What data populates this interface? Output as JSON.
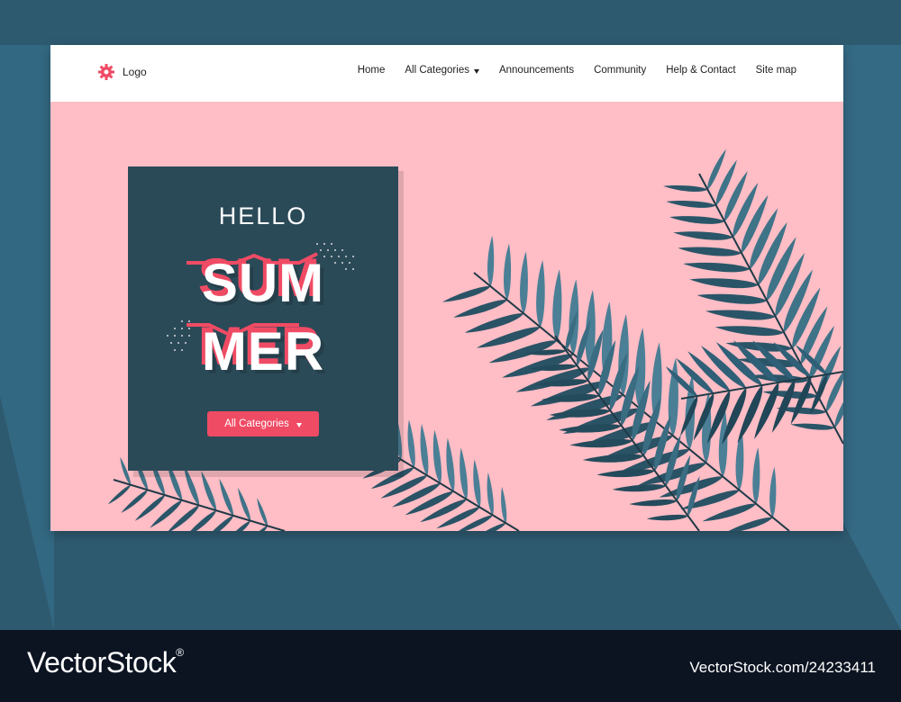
{
  "navbar": {
    "logo_label": "Logo",
    "items": [
      {
        "label": "Home"
      },
      {
        "label": "All Categories"
      },
      {
        "label": "Announcements"
      },
      {
        "label": "Community"
      },
      {
        "label": "Help & Contact"
      },
      {
        "label": "Site map"
      }
    ]
  },
  "hero": {
    "greeting": "HELLO",
    "headline_line1": "SUM",
    "headline_line2": "MER",
    "cta_label": "All Categories"
  },
  "footer": {
    "brand": "VectorStock",
    "registered": "®",
    "stock_id": "VectorStock.com/24233411"
  },
  "colors": {
    "background": "#2e5a70",
    "page_pink": "#ffbdc5",
    "card": "#2b4a58",
    "accent": "#f04b64",
    "footer": "#0c1422",
    "leaf": "#3f7388"
  },
  "icons": {
    "logo": "gear-icon",
    "dropdown": "caret-down-icon"
  }
}
